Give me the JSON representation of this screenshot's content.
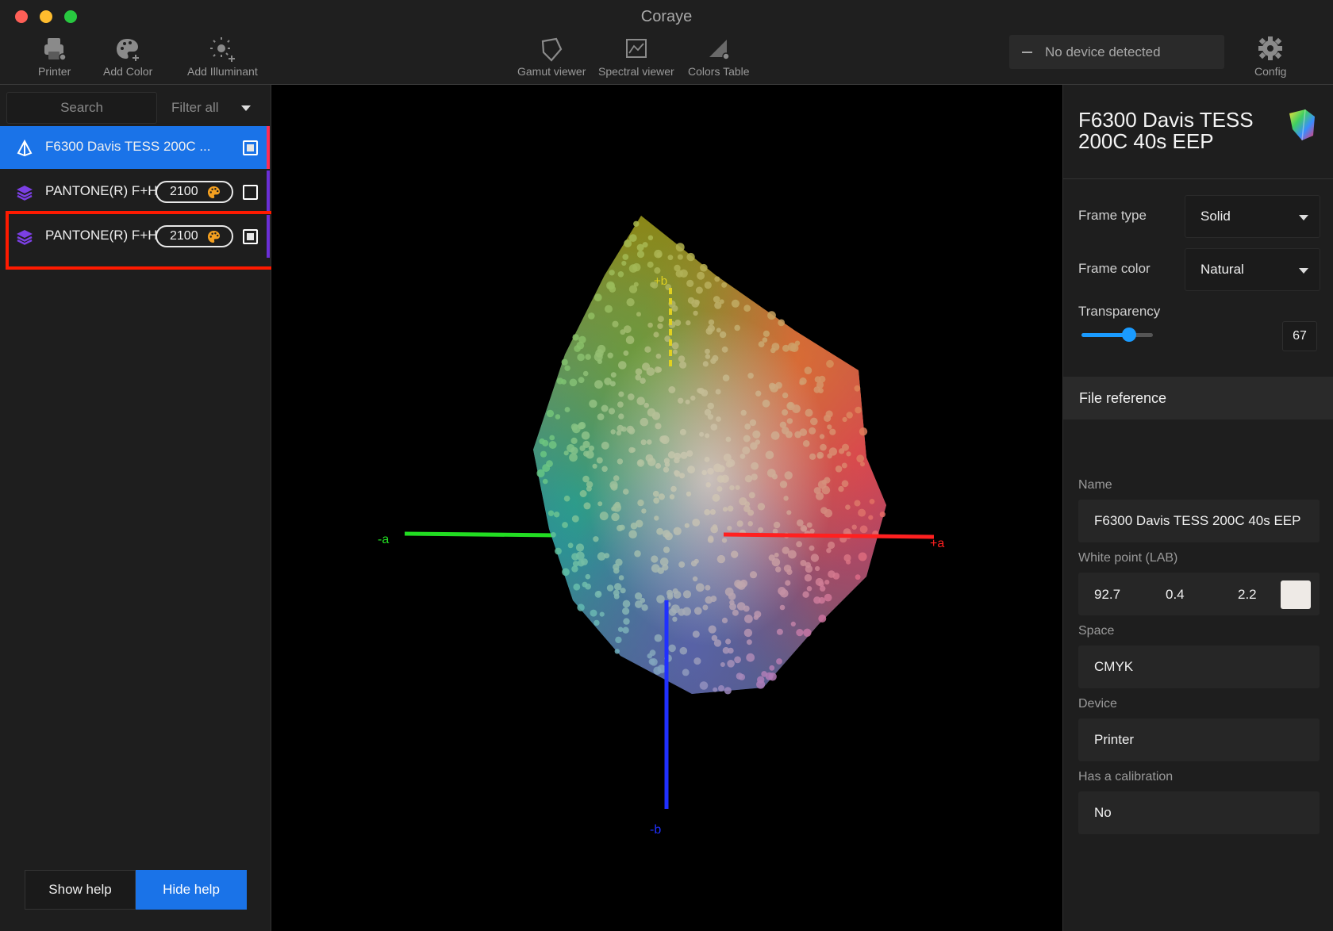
{
  "window": {
    "title": "Coraye"
  },
  "toolbar": {
    "printer": "Printer",
    "add_color": "Add Color",
    "add_illuminant": "Add Illuminant",
    "gamut_viewer": "Gamut viewer",
    "spectral_viewer": "Spectral viewer",
    "colors_table": "Colors Table",
    "config": "Config",
    "device_status": "No device detected"
  },
  "sidebar": {
    "search_placeholder": "Search",
    "filter_label": "Filter all",
    "items": [
      {
        "label": "F6300 Davis TESS 200C ...",
        "icon": "gamut-pyramid-icon",
        "checked": true,
        "selected": true,
        "stripe_color": "#ff2d55"
      },
      {
        "label": "PANTONE(R) F+H",
        "badge": "2100",
        "icon": "layers-icon",
        "checked": false,
        "selected": false,
        "stripe_color": "#6b2fd6"
      },
      {
        "label": "PANTONE(R) F+H",
        "badge": "2100",
        "icon": "layers-icon",
        "checked": true,
        "selected": false,
        "stripe_color": "#6b2fd6"
      }
    ],
    "show_help": "Show help",
    "hide_help": "Hide help"
  },
  "viewer": {
    "axis_labels": {
      "plus_b": "+b",
      "minus_b": "-b",
      "plus_a": "+a",
      "minus_a": "-a"
    },
    "axis_colors": {
      "plus_b": "#e0d020",
      "minus_b": "#2030ff",
      "plus_a": "#ff2020",
      "minus_a": "#22dd22"
    }
  },
  "details": {
    "title": "F6300 Davis TESS 200C 40s EEP",
    "frame_type_label": "Frame type",
    "frame_type_value": "Solid",
    "frame_color_label": "Frame color",
    "frame_color_value": "Natural",
    "transparency_label": "Transparency",
    "transparency_value": "67",
    "transparency_fraction": 0.67,
    "file_reference_label": "File reference",
    "name_label": "Name",
    "name_value": "F6300 Davis TESS 200C 40s EEP",
    "white_point_label": "White point (LAB)",
    "white_point": {
      "L": "92.7",
      "a": "0.4",
      "b": "2.2",
      "swatch_color": "#eeeae6"
    },
    "space_label": "Space",
    "space_value": "CMYK",
    "device_label": "Device",
    "device_value": "Printer",
    "calibration_label": "Has a calibration",
    "calibration_value": "No"
  },
  "colors": {
    "accent": "#1a73e8",
    "highlight": "#ff1a00"
  }
}
